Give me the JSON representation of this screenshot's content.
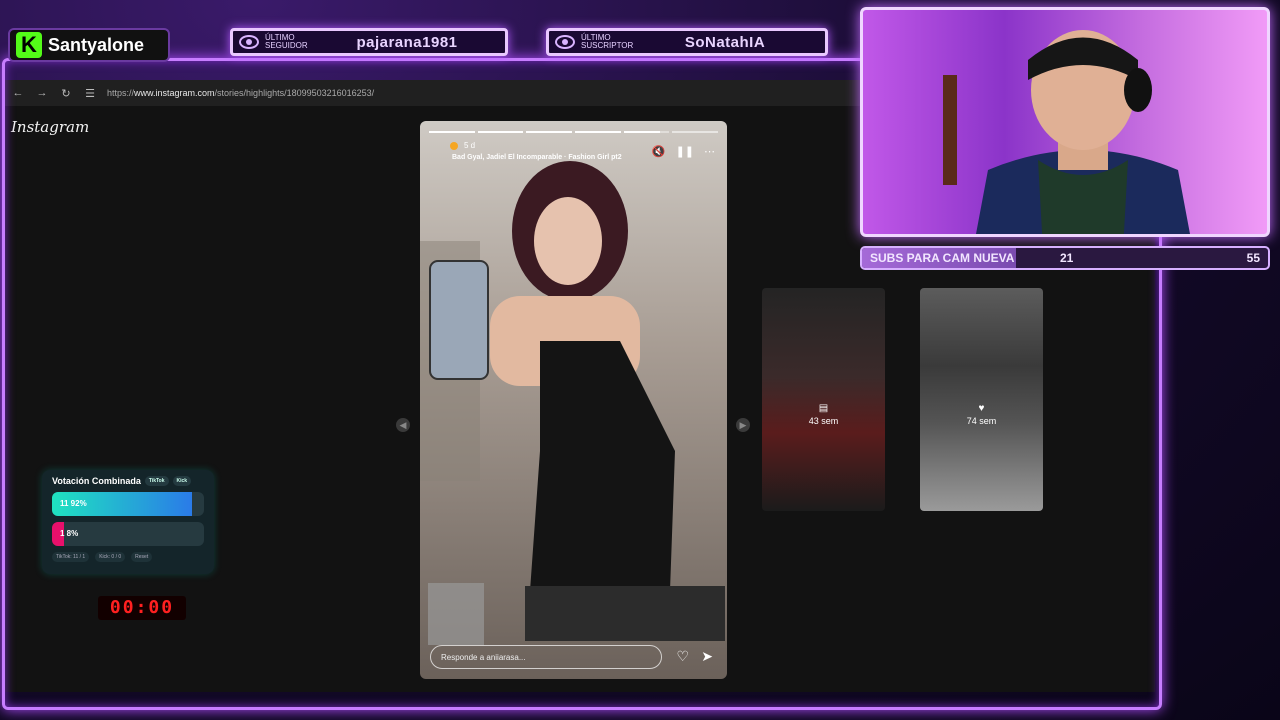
{
  "brand": {
    "logo_letter": "K",
    "channel_name": "Santyalone",
    "accent": "#53fc18"
  },
  "last_follower": {
    "label_line1": "ÚLTIMO",
    "label_line2": "SEGUIDOR",
    "name": "pajarana1981"
  },
  "last_subscriber": {
    "label_line1": "ÚLTIMO",
    "label_line2": "SUSCRIPTOR",
    "name": "SoNatahIA"
  },
  "subs_goal": {
    "label": "SUBS PARA CAM NUEVA",
    "current": "21",
    "goal": "55",
    "progress": 0.38
  },
  "browser": {
    "url_prefix": "https://",
    "url_domain": "www.instagram.com",
    "url_path": "/stories/highlights/18099503216016253/"
  },
  "instagram": {
    "logo_text": "Instagram",
    "story": {
      "time_ago": "5 d",
      "song": "Bad Gyal, Jadiel El Incomparable · Fashion Girl pt2",
      "reply_placeholder": "Responde a aniiarasa...",
      "segments": 6,
      "active_segment": 5
    },
    "side_stories": [
      {
        "label": "43 sem"
      },
      {
        "label": "74 sem"
      }
    ]
  },
  "vote": {
    "title": "Votación Combinada",
    "chip_tiktok": "TikTok",
    "chip_kick": "Kick",
    "option1": {
      "text": "11  92%",
      "percent": 92,
      "color": "#1fe3c0"
    },
    "option2": {
      "text": "1  8%",
      "percent": 8,
      "color": "#e8106b"
    },
    "footer": {
      "tiktok": "TikTok: 11 / 1",
      "kick": "Kick: 0 / 0",
      "reset": "Reset"
    }
  },
  "timer": {
    "value": "00:00"
  }
}
